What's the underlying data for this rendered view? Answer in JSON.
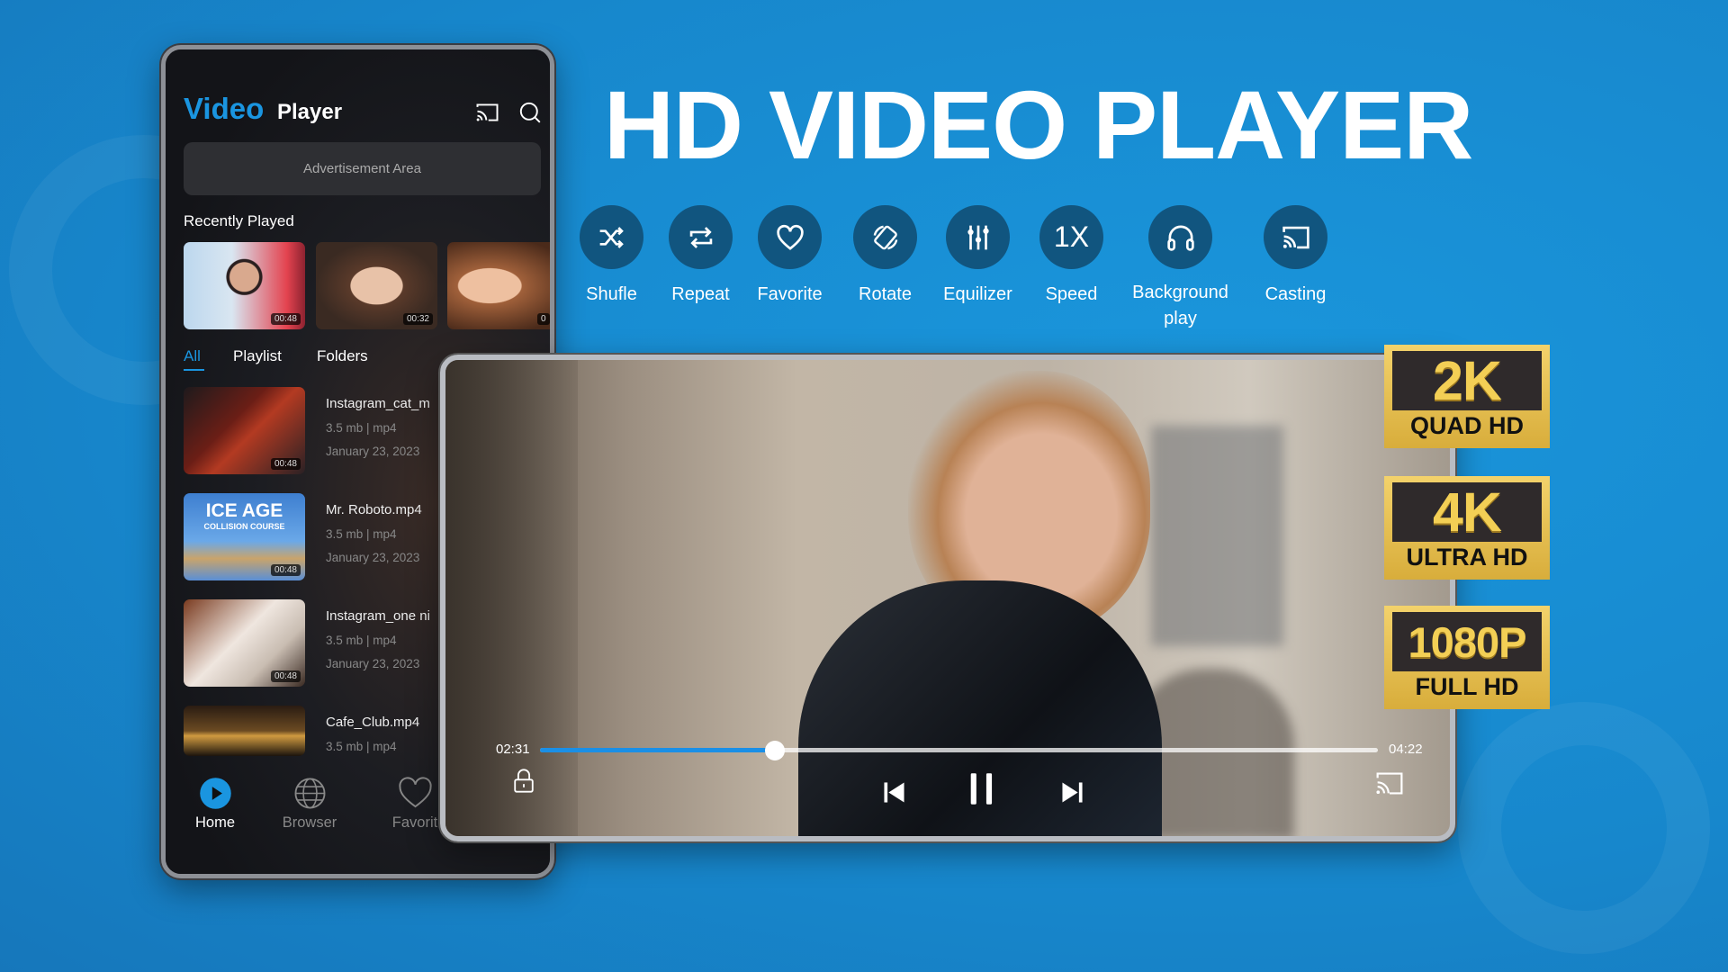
{
  "headline": "HD VIDEO PLAYER",
  "colors": {
    "accent": "#1a95e0",
    "background": "#1787cc",
    "feature_circle": "#11557f",
    "badge_gold": "#e6bf4f"
  },
  "features": [
    {
      "label": "Shufle",
      "icon": "shuffle-icon"
    },
    {
      "label": "Repeat",
      "icon": "repeat-icon"
    },
    {
      "label": "Favorite",
      "icon": "heart-icon"
    },
    {
      "label": "Rotate",
      "icon": "rotate-icon"
    },
    {
      "label": "Equilizer",
      "icon": "equalizer-icon"
    },
    {
      "label": "Speed",
      "icon": "speed-icon",
      "glyph": "1X"
    },
    {
      "label": "Background play",
      "icon": "headphones-icon"
    },
    {
      "label": "Casting",
      "icon": "cast-icon"
    }
  ],
  "phone": {
    "title_accent": "Video",
    "title_rest": "Player",
    "ad_text": "Advertisement Area",
    "recent_title": "Recently Played",
    "recent": [
      {
        "duration": "00:48"
      },
      {
        "duration": "00:32"
      },
      {
        "duration": "0"
      }
    ],
    "tabs": [
      "All",
      "Playlist",
      "Folders"
    ],
    "active_tab": "All",
    "videos": [
      {
        "name": "Instagram_cat_m",
        "meta": "3.5 mb | mp4",
        "date": "January 23, 2023",
        "duration": "00:48"
      },
      {
        "name": "Mr. Roboto.mp4",
        "meta": "3.5 mb | mp4",
        "date": "January 23, 2023",
        "duration": "00:48",
        "thumb_text": "ICE AGE",
        "thumb_sub": "COLLISION COURSE"
      },
      {
        "name": "Instagram_one ni",
        "meta": "3.5 mb | mp4",
        "date": "January 23, 2023",
        "duration": "00:48"
      },
      {
        "name": "Cafe_Club.mp4",
        "meta": "3.5 mb | mp4"
      }
    ],
    "nav": [
      {
        "label": "Home",
        "active": true
      },
      {
        "label": "Browser"
      },
      {
        "label": "Favorit"
      }
    ]
  },
  "player": {
    "elapsed": "02:31",
    "total": "04:22",
    "progress": 0.28
  },
  "badges": [
    {
      "big": "2K",
      "small": "QUAD HD"
    },
    {
      "big": "4K",
      "small": "ULTRA HD"
    },
    {
      "big": "1080P",
      "small": "FULL HD"
    }
  ]
}
